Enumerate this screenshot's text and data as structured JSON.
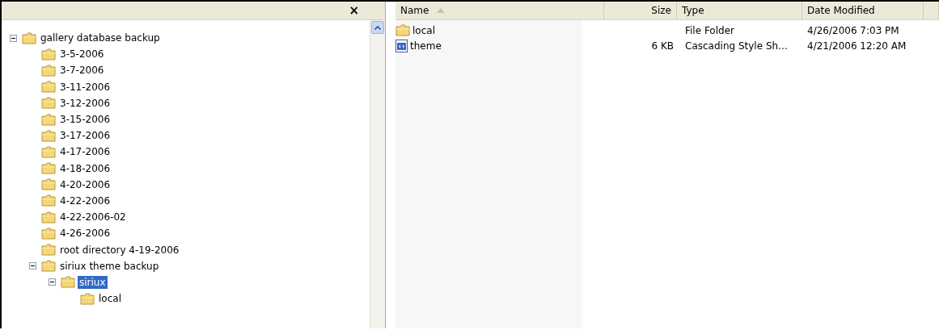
{
  "folder_pane": {
    "close": "×",
    "tree": [
      {
        "label": "gallery database backup",
        "expanded": true,
        "selected": false,
        "children": [
          {
            "label": "3-5-2006",
            "selected": false
          },
          {
            "label": "3-7-2006",
            "selected": false
          },
          {
            "label": "3-11-2006",
            "selected": false
          },
          {
            "label": "3-12-2006",
            "selected": false
          },
          {
            "label": "3-15-2006",
            "selected": false
          },
          {
            "label": "3-17-2006",
            "selected": false
          },
          {
            "label": "4-17-2006",
            "selected": false
          },
          {
            "label": "4-18-2006",
            "selected": false
          },
          {
            "label": "4-20-2006",
            "selected": false
          },
          {
            "label": "4-22-2006",
            "selected": false
          },
          {
            "label": "4-22-2006-02",
            "selected": false
          },
          {
            "label": "4-26-2006",
            "selected": false
          },
          {
            "label": "root directory 4-19-2006",
            "selected": false
          },
          {
            "label": "siriux theme backup",
            "expanded": true,
            "selected": false,
            "children": [
              {
                "label": "siriux",
                "expanded": true,
                "selected": true,
                "children": [
                  {
                    "label": "local",
                    "selected": false
                  }
                ]
              }
            ]
          }
        ]
      }
    ]
  },
  "file_list": {
    "columns": [
      {
        "label": "Name",
        "sorted": true
      },
      {
        "label": "Size",
        "sorted": false
      },
      {
        "label": "Type",
        "sorted": false
      },
      {
        "label": "Date Modified",
        "sorted": false
      }
    ],
    "rows": [
      {
        "kind": "folder",
        "name": "local",
        "size": "",
        "type": "File Folder",
        "date": "4/26/2006 7:03 PM"
      },
      {
        "kind": "stylesheet",
        "name": "theme",
        "size": "6 KB",
        "type": "Cascading Style Sh…",
        "date": "4/21/2006 12:20 AM"
      }
    ]
  }
}
